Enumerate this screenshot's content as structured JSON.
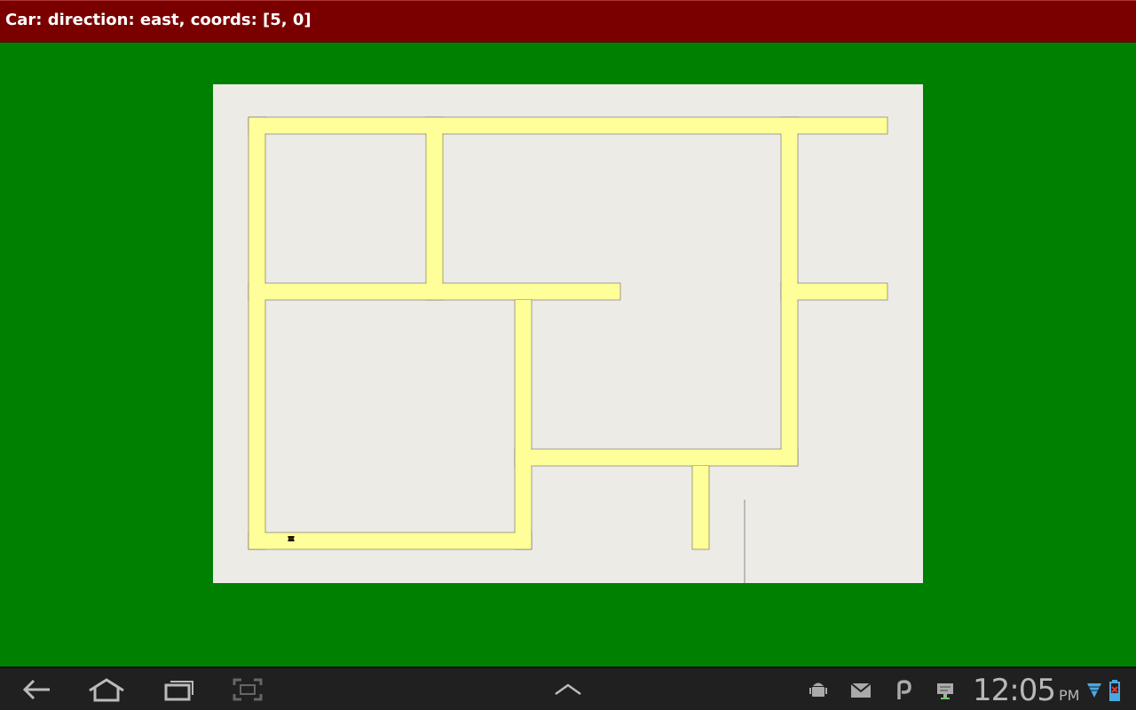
{
  "header": {
    "status_text": "Car: direction: east, coords: [5, 0]"
  },
  "colors": {
    "title_bar": "#7a0000",
    "background": "#008000",
    "map_background": "#edebe6",
    "road": "#ffff99",
    "road_edge": "#6a6a5a",
    "nav_bar": "#202020"
  },
  "nav_bar": {
    "back_icon": "back-arrow-icon",
    "home_icon": "home-icon",
    "recent_icon": "recent-apps-icon",
    "screenshot_icon": "screenshot-icon",
    "menu_icon": "chevron-up-icon"
  },
  "status_bar": {
    "time": "12:05",
    "ampm": "PM",
    "icons": [
      "android-debug-icon",
      "gmail-icon",
      "p-app-icon",
      "notification-icon",
      "wifi-icon",
      "battery-icon"
    ]
  }
}
